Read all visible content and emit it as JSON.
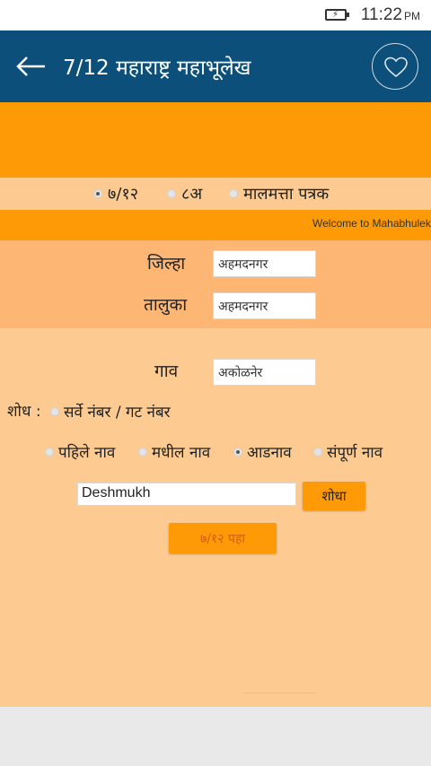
{
  "status": {
    "time": "11:22",
    "ampm": "PM"
  },
  "appbar": {
    "title": "7/12 महाराष्ट्र  महाभूलेख",
    "back_icon": "arrow-left-icon",
    "fav_icon": "heart-icon"
  },
  "doc_types": [
    {
      "label": "७/१२",
      "checked": true
    },
    {
      "label": "८अ",
      "checked": false
    },
    {
      "label": "मालमत्ता पत्रक",
      "checked": false
    }
  ],
  "ticker": "Welcome to Mahabhulekh",
  "location": {
    "district_label": "जिल्हा",
    "district_value": "अहमदनगर",
    "taluka_label": "तालुका",
    "taluka_value": "अहमदनगर",
    "village_label": "गाव",
    "village_value": "अकोळनेर"
  },
  "search": {
    "label": "शोध :",
    "survey_option": "सर्वे नंबर / गट नंबर",
    "name_options": [
      {
        "label": "पहिले नाव",
        "checked": false
      },
      {
        "label": "मधील नाव",
        "checked": false
      },
      {
        "label": "आडनाव",
        "checked": true
      },
      {
        "label": "संपूर्ण नाव",
        "checked": false
      }
    ],
    "input_value": "Deshmukh",
    "search_button": "शोधा",
    "view_button": "७/१२ पहा"
  },
  "colors": {
    "appbar": "#0b4f7a",
    "orange": "#fd9a06",
    "light_orange": "#fdcb92",
    "mid_orange": "#fdb673"
  }
}
